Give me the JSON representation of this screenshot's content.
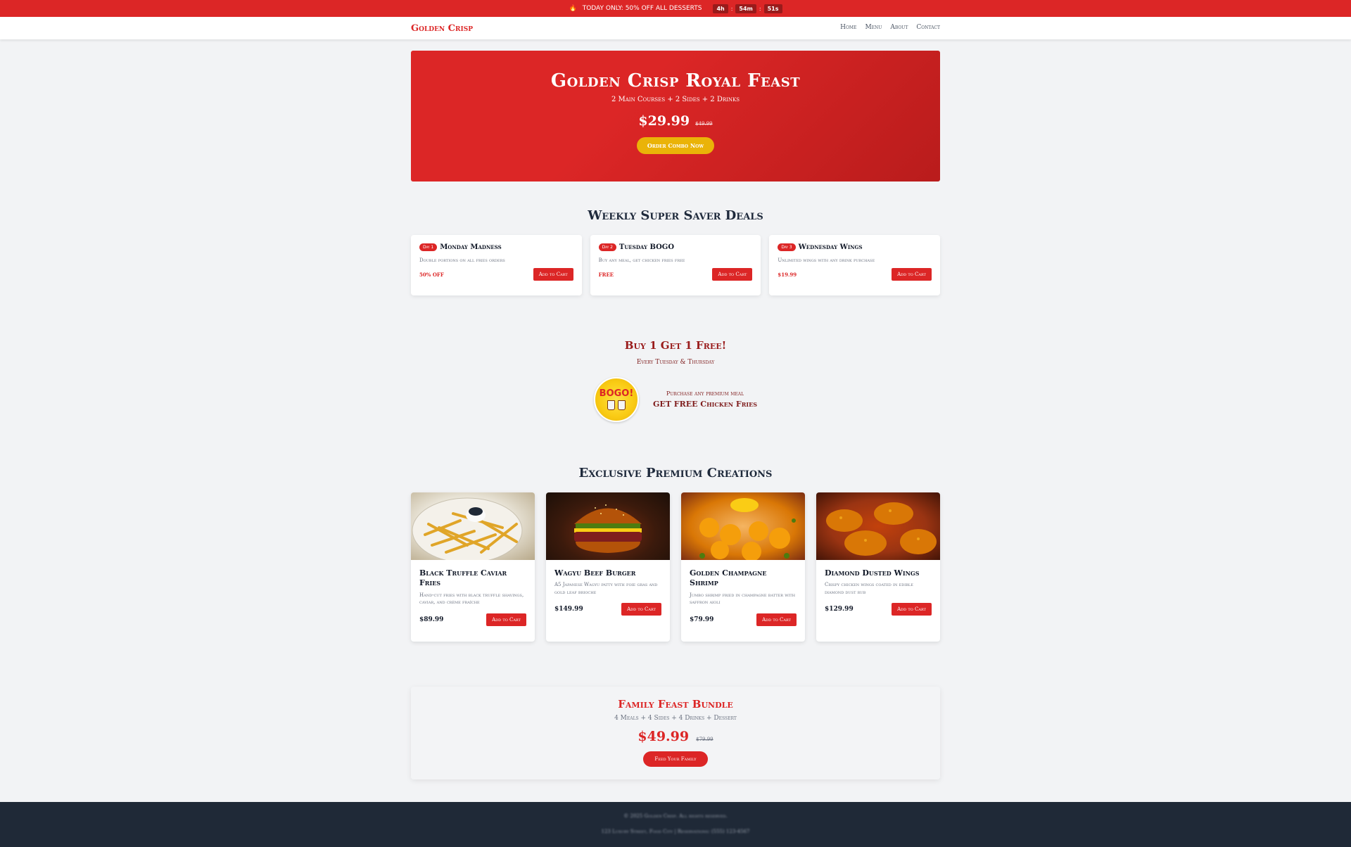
{
  "promo": {
    "icon": "flame-icon",
    "text": "TODAY ONLY: 50% OFF ALL DESSERTS",
    "timer_h": "4h",
    "timer_m": "54m",
    "timer_s": "51s",
    "sep": ":"
  },
  "nav": {
    "logo": "Golden Crisp",
    "links": [
      "Home",
      "Menu",
      "About",
      "Contact"
    ]
  },
  "hero": {
    "title": "Golden Crisp Royal Feast",
    "subtitle": "2 Main Courses + 2 Sides + 2 Drinks",
    "price": "$29.99",
    "old_price": "$49.99",
    "cta": "Order Combo Now"
  },
  "deals": {
    "title": "Weekly Super Saver Deals",
    "items": [
      {
        "badge": "Day 1",
        "title": "Monday Madness",
        "desc": "Double portions on all fries orders",
        "value": "50% OFF",
        "button": "Add to Cart"
      },
      {
        "badge": "Day 2",
        "title": "Tuesday BOGO",
        "desc": "Buy any meal, get chicken fries free",
        "value": "FREE",
        "button": "Add to Cart"
      },
      {
        "badge": "Day 3",
        "title": "Wednesday Wings",
        "desc": "Unlimited wings with any drink purchase",
        "value": "$19.99",
        "button": "Add to Cart"
      }
    ]
  },
  "bogo": {
    "title": "Buy 1 Get 1 Free!",
    "subtitle": "Every Tuesday & Thursday",
    "image_word": "BOGO!",
    "line1": "Purchase any premium meal",
    "line2": "GET FREE Chicken Fries"
  },
  "premium": {
    "title": "Exclusive Premium Creations",
    "items": [
      {
        "name": "Black Truffle Caviar Fries",
        "desc": "Hand-cut fries with black truffle shavings, caviar, and crème fraîche",
        "price": "$89.99",
        "button": "Add to Cart"
      },
      {
        "name": "Wagyu Beef Burger",
        "desc": "A5 Japanese Wagyu patty with foie gras and gold leaf brioche",
        "price": "$149.99",
        "button": "Add to Cart"
      },
      {
        "name": "Golden Champagne Shrimp",
        "desc": "Jumbo shrimp fried in champagne batter with saffron aioli",
        "price": "$79.99",
        "button": "Add to Cart"
      },
      {
        "name": "Diamond Dusted Wings",
        "desc": "Crispy chicken wings coated in edible diamond dust rub",
        "price": "$129.99",
        "button": "Add to Cart"
      }
    ]
  },
  "family": {
    "title": "Family Feast Bundle",
    "subtitle": "4 Meals + 4 Sides + 4 Drinks + Dessert",
    "price": "$49.99",
    "old_price": "$79.99",
    "cta": "Feed Your Family"
  },
  "footer": {
    "line1": "© 2025 Golden Crisp. All rights reserved.",
    "line2": "123 Luxury Street, Food City | Reservations: (555) 123-4567"
  },
  "colors": {
    "brand_red": "#dc2626",
    "dark_red": "#991b1b",
    "gold": "#eab308",
    "footer_bg": "#1f2937"
  }
}
